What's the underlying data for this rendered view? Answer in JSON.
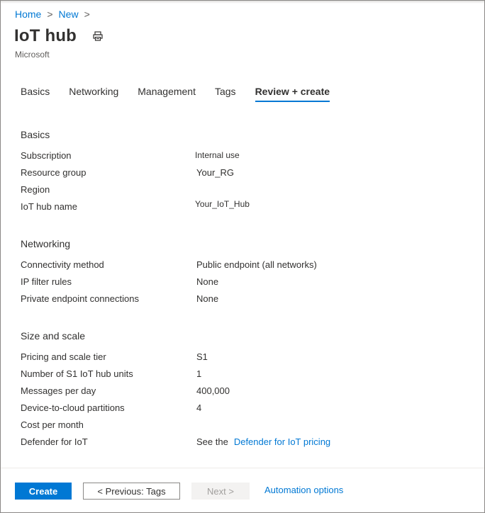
{
  "breadcrumb": {
    "items": [
      "Home",
      "New"
    ],
    "separator": ">"
  },
  "page": {
    "title": "IoT hub",
    "publisher": "Microsoft"
  },
  "icons": {
    "print": "print-icon"
  },
  "tabs": [
    {
      "label": "Basics",
      "active": false
    },
    {
      "label": "Networking",
      "active": false
    },
    {
      "label": "Management",
      "active": false
    },
    {
      "label": "Tags",
      "active": false
    },
    {
      "label": "Review + create",
      "active": true
    }
  ],
  "sections": {
    "basics": {
      "heading": "Basics",
      "rows": [
        {
          "label": "Subscription",
          "value": "Internal use"
        },
        {
          "label": "Resource group",
          "value": "Your_RG"
        },
        {
          "label": "Region",
          "value": ""
        },
        {
          "label": "IoT hub name",
          "value": "Your_IoT_Hub"
        }
      ]
    },
    "networking": {
      "heading": "Networking",
      "rows": [
        {
          "label": "Connectivity method",
          "value": "Public endpoint (all networks)"
        },
        {
          "label": "IP filter rules",
          "value": "None"
        },
        {
          "label": "Private endpoint connections",
          "value": "None"
        }
      ]
    },
    "size": {
      "heading": "Size and scale",
      "rows": [
        {
          "label": "Pricing and scale tier",
          "value": "S1"
        },
        {
          "label": "Number of S1 IoT hub units",
          "value": "1"
        },
        {
          "label": "Messages per day",
          "value": "400,000"
        },
        {
          "label": "Device-to-cloud partitions",
          "value": "4"
        },
        {
          "label": "Cost per month",
          "value": ""
        },
        {
          "label": "Defender for IoT",
          "value": "See the",
          "link": "Defender for IoT pricing"
        }
      ]
    }
  },
  "footer": {
    "create": "Create",
    "previous": "< Previous: Tags",
    "next": "Next >",
    "automation": "Automation options"
  },
  "colors": {
    "accent": "#0078d4",
    "text": "#323130",
    "muted": "#605e5c",
    "disabled_bg": "#f3f2f1",
    "disabled_text": "#a19f9d"
  }
}
